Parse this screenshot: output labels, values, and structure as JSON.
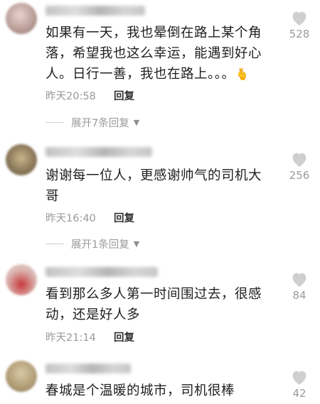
{
  "comments": [
    {
      "text": "如果有一天，我也晕倒在路上某个角落，希望我也这么幸运，能遇到好心人。日行一善，我也在路上。。。",
      "emoji": "🫰",
      "time": "昨天20:58",
      "reply": "回复",
      "likes": "528",
      "expand": "展开7条回复"
    },
    {
      "text": "谢谢每一位人，更感谢帅气的司机大哥",
      "time": "昨天16:40",
      "reply": "回复",
      "likes": "256",
      "expand": "展开1条回复"
    },
    {
      "text": "看到那么多人第一时间围过去，很感动，还是好人多",
      "time": "昨天21:14",
      "reply": "回复",
      "likes": "84"
    },
    {
      "text": "春城是个温暖的城市，司机很棒",
      "likes": "42"
    }
  ],
  "icons": {
    "like": "heart-icon",
    "expand": "triangle-down-icon"
  },
  "colors": {
    "muted": "#9a9a9a",
    "heart": "#cfcfcf"
  }
}
